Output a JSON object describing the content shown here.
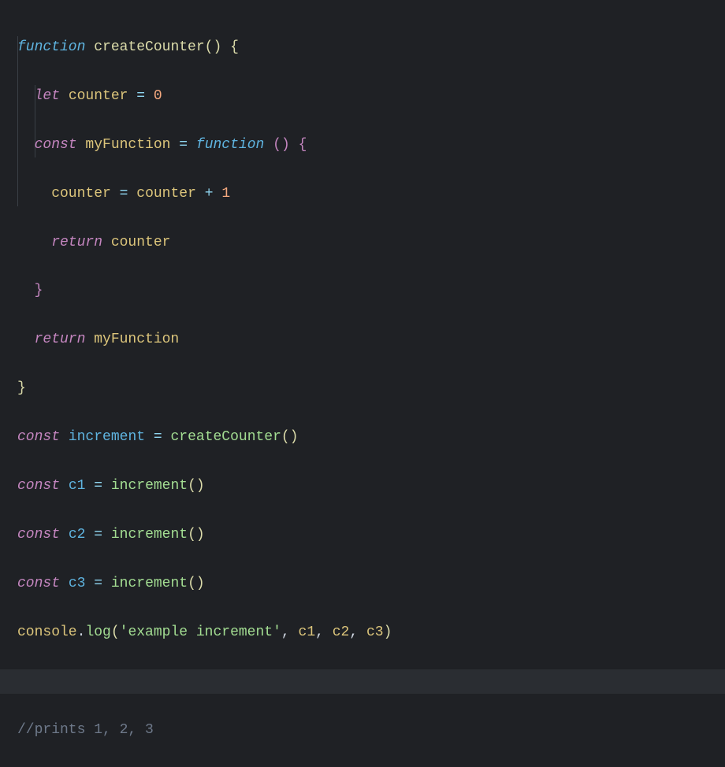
{
  "code": {
    "l1": {
      "kw_function": "function",
      "fn_name": "createCounter",
      "par_open": "(",
      "par_close": ")",
      "brace_open": "{"
    },
    "l2": {
      "kw_let": "let",
      "var": "counter",
      "eq": "=",
      "num": "0"
    },
    "l3": {
      "kw_const": "const",
      "var": "myFunction",
      "eq": "=",
      "kw_function": "function",
      "par_open": "(",
      "par_close": ")",
      "brace_open": "{"
    },
    "l4": {
      "lhs": "counter",
      "eq": "=",
      "rhs_a": "counter",
      "op": "+",
      "rhs_b": "1"
    },
    "l5": {
      "kw_return": "return",
      "var": "counter"
    },
    "l6": {
      "brace_close": "}"
    },
    "l7": {
      "kw_return": "return",
      "var": "myFunction"
    },
    "l8": {
      "brace_close": "}"
    },
    "l9": {
      "kw_const": "const",
      "var": "increment",
      "eq": "=",
      "call": "createCounter",
      "par_open": "(",
      "par_close": ")"
    },
    "l10": {
      "kw_const": "const",
      "var": "c1",
      "eq": "=",
      "call": "increment",
      "par_open": "(",
      "par_close": ")"
    },
    "l11": {
      "kw_const": "const",
      "var": "c2",
      "eq": "=",
      "call": "increment",
      "par_open": "(",
      "par_close": ")"
    },
    "l12": {
      "kw_const": "const",
      "var": "c3",
      "eq": "=",
      "call": "increment",
      "par_open": "(",
      "par_close": ")"
    },
    "l13": {
      "obj": "console",
      "dot": ".",
      "method": "log",
      "par_open": "(",
      "str": "'example increment'",
      "comma": ",",
      "a1": "c1",
      "a2": "c2",
      "a3": "c3",
      "par_close": ")"
    },
    "l14": {
      "blank": ""
    },
    "l15": {
      "comment": "//prints 1, 2, 3"
    }
  }
}
